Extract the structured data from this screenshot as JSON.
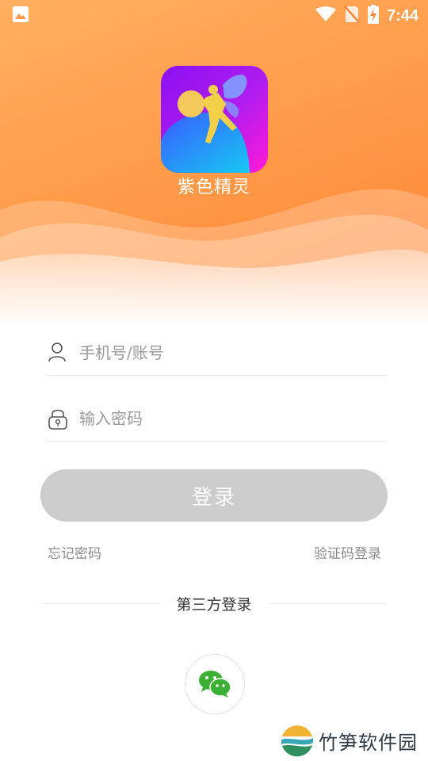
{
  "status_bar": {
    "time": "7:44",
    "icons": [
      "gallery-icon",
      "wifi-icon",
      "no-sim-icon",
      "battery-charging-icon"
    ]
  },
  "app": {
    "name": "紫色精灵",
    "logo_icon": "fairy-logo-icon"
  },
  "form": {
    "account_placeholder": "手机号/账号",
    "password_placeholder": "输入密码",
    "login_label": "登录",
    "forgot_password": "忘记密码",
    "code_login": "验证码登录"
  },
  "third_party": {
    "title": "第三方登录",
    "wechat_icon": "wechat-icon"
  },
  "watermark": {
    "text": "竹笋软件园"
  },
  "colors": {
    "hero_orange": "#ff8a3c",
    "button_disabled": "#cccccc",
    "wechat_green": "#3cb034"
  }
}
